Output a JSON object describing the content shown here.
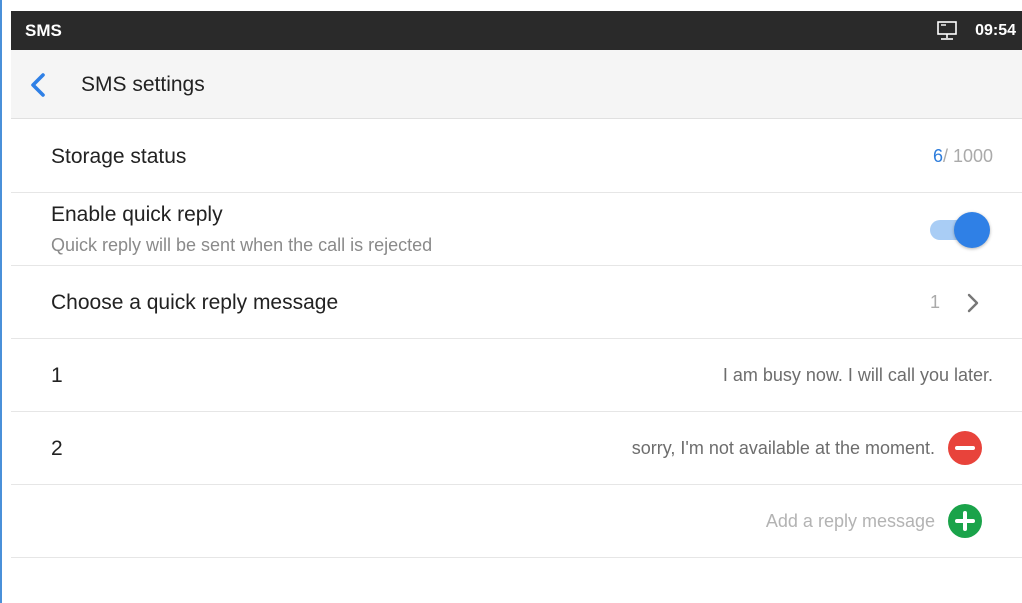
{
  "statusbar": {
    "app_name": "SMS",
    "network_icon": "network-monitor-icon",
    "time": "09:54"
  },
  "header": {
    "back_icon": "chevron-left-icon",
    "title": "SMS settings"
  },
  "settings": {
    "storage": {
      "label": "Storage status",
      "used": "6",
      "total": "/ 1000"
    },
    "quick_reply": {
      "label": "Enable quick reply",
      "description": "Quick reply will be sent when the call is rejected",
      "enabled": true
    },
    "choose_message": {
      "label": "Choose a quick reply message",
      "value": "1",
      "icon": "chevron-right-icon"
    },
    "messages": [
      {
        "index": "1",
        "text": "I am busy now. I will call you later."
      },
      {
        "index": "2",
        "text": "sorry, I'm not available at the moment.",
        "action_icon": "remove-circle-icon"
      }
    ],
    "add_message": {
      "placeholder": "Add a reply message",
      "icon": "add-circle-icon"
    }
  },
  "colors": {
    "accent": "#2f80e6",
    "remove": "#e8433b",
    "add": "#1aa34a",
    "statusbar": "#2a2a2a"
  }
}
